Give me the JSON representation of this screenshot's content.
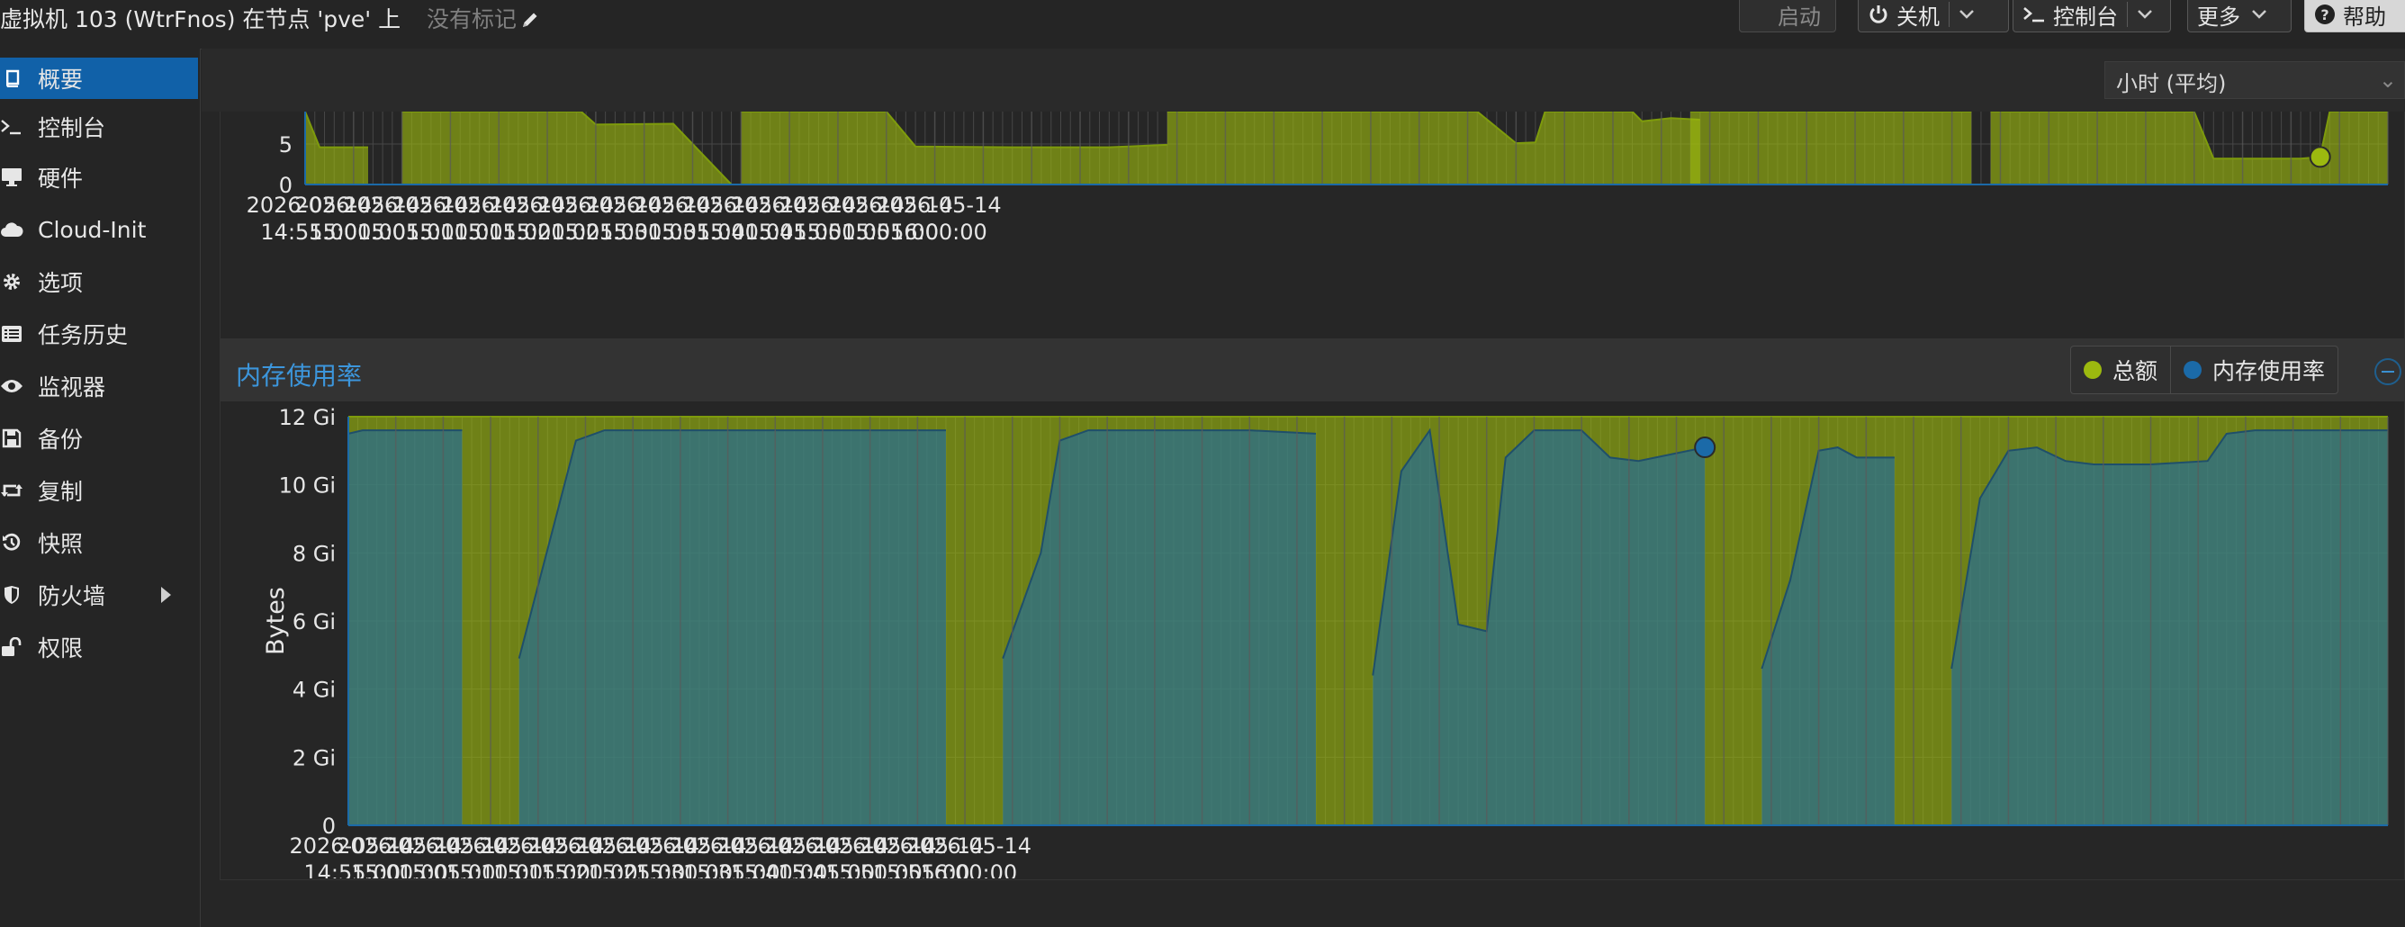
{
  "header": {
    "title": "虚拟机 103 (WtrFnos) 在节点 'pve' 上",
    "no_tags": "没有标记",
    "buttons": {
      "start": "启动",
      "shutdown": "关机",
      "console": "控制台",
      "more": "更多",
      "help": "帮助"
    }
  },
  "sidebar": {
    "items": [
      {
        "label": "概要",
        "icon": "book-icon"
      },
      {
        "label": "控制台",
        "icon": "terminal-icon"
      },
      {
        "label": "硬件",
        "icon": "desktop-icon"
      },
      {
        "label": "Cloud-Init",
        "icon": "cloud-icon"
      },
      {
        "label": "选项",
        "icon": "gear-icon"
      },
      {
        "label": "任务历史",
        "icon": "list-icon"
      },
      {
        "label": "监视器",
        "icon": "eye-icon"
      },
      {
        "label": "备份",
        "icon": "floppy-icon"
      },
      {
        "label": "复制",
        "icon": "retweet-icon"
      },
      {
        "label": "快照",
        "icon": "history-icon"
      },
      {
        "label": "防火墙",
        "icon": "shield-icon"
      },
      {
        "label": "权限",
        "icon": "unlock-icon"
      }
    ]
  },
  "timeframe": {
    "selected": "小时 (平均)"
  },
  "colors": {
    "total": "#9cb90f",
    "usage": "#1b6aa8",
    "active": "#1161a8",
    "title": "#3c96dc"
  },
  "time_labels": [
    [
      "2026-05-14",
      "14:55:00"
    ],
    [
      "2026-05-14",
      "15:00:00"
    ],
    [
      "2026-05-14",
      "15:05:00"
    ],
    [
      "2026-05-14",
      "15:10:00"
    ],
    [
      "2026-05-14",
      "15:15:00"
    ],
    [
      "2026-05-14",
      "15:20:00"
    ],
    [
      "2026-05-14",
      "15:25:00"
    ],
    [
      "2026-05-14",
      "15:30:00"
    ],
    [
      "2026-05-14",
      "15:35:00"
    ],
    [
      "2026-05-14",
      "15:40:00"
    ],
    [
      "2026-05-14",
      "15:45:00"
    ],
    [
      "2026-05-14",
      "15:50:00"
    ],
    [
      "2026-05-14",
      "15:55:00"
    ],
    [
      "2026-05-14",
      "16:00:00"
    ]
  ],
  "memory_panel": {
    "title": "内存使用率",
    "legend": [
      "总额",
      "内存使用率"
    ]
  },
  "chart_data": [
    {
      "type": "area",
      "x_start": "14:55:00",
      "ylim": [
        0,
        9
      ],
      "yticks": [
        "0",
        "5"
      ],
      "series": [
        {
          "name": "总额",
          "segments": [
            [
              [
                0,
                9
              ],
              [
                1.5,
                4.6
              ],
              [
                6.5,
                4.6
              ]
            ],
            [
              [
                10,
                9
              ],
              [
                28.5,
                9
              ],
              [
                30,
                7.4
              ],
              [
                38,
                7.5
              ],
              [
                40,
                5
              ],
              [
                44,
                0
              ],
              [
                45,
                0
              ]
            ],
            [
              [
                45,
                9
              ],
              [
                60,
                9
              ],
              [
                63,
                4.7
              ],
              [
                73,
                4.6
              ],
              [
                83,
                4.6
              ],
              [
                89,
                4.9
              ]
            ],
            [
              [
                89,
                9
              ],
              [
                121,
                9
              ],
              [
                125,
                5.1
              ],
              [
                127,
                5.2
              ],
              [
                128,
                9
              ],
              [
                137,
                9
              ],
              [
                138,
                7.8
              ],
              [
                141,
                8.2
              ],
              [
                144,
                8
              ]
            ],
            [
              [
                143,
                9
              ],
              [
                172,
                9
              ]
            ],
            [
              [
                174,
                9
              ],
              [
                195,
                9
              ],
              [
                197,
                3.2
              ],
              [
                206,
                3.2
              ],
              [
                208,
                3.4
              ],
              [
                209,
                9
              ],
              [
                215,
                9
              ]
            ]
          ]
        }
      ],
      "highlight": {
        "series": "总额",
        "x": 208,
        "y": 3.4
      }
    },
    {
      "type": "area",
      "title": "内存使用率",
      "x_start": "14:55:00",
      "ylabel": "Bytes",
      "ylim": [
        0,
        12
      ],
      "yticks": [
        "0",
        "2 Gi",
        "4 Gi",
        "6 Gi",
        "8 Gi",
        "10 Gi",
        "12 Gi"
      ],
      "series": [
        {
          "name": "总额",
          "segments": [
            [
              [
                0,
                12
              ],
              [
                215,
                12
              ]
            ]
          ]
        },
        {
          "name": "内存使用率",
          "segments": [
            [
              [
                0,
                11.5
              ],
              [
                1.5,
                11.6
              ],
              [
                12,
                11.6
              ]
            ],
            [
              [
                18,
                4.9
              ],
              [
                24,
                11.3
              ],
              [
                27,
                11.6
              ],
              [
                37,
                11.6
              ],
              [
                50,
                11.6
              ],
              [
                63,
                11.6
              ]
            ],
            [
              [
                69,
                4.9
              ],
              [
                73,
                8
              ],
              [
                75,
                11.3
              ],
              [
                78,
                11.6
              ],
              [
                95,
                11.6
              ],
              [
                102,
                11.5
              ]
            ],
            [
              [
                108,
                4.4
              ],
              [
                111,
                10.4
              ],
              [
                114,
                11.6
              ],
              [
                117,
                5.9
              ],
              [
                120,
                5.7
              ],
              [
                122,
                10.8
              ],
              [
                125,
                11.6
              ],
              [
                130,
                11.6
              ],
              [
                133,
                10.8
              ],
              [
                136,
                10.7
              ],
              [
                143,
                11.1
              ]
            ],
            [
              [
                149,
                4.6
              ],
              [
                152,
                7.2
              ],
              [
                155,
                11
              ],
              [
                157,
                11.1
              ],
              [
                159,
                10.8
              ],
              [
                163,
                10.8
              ]
            ],
            [
              [
                169,
                4.6
              ],
              [
                172,
                9.6
              ],
              [
                175,
                11
              ],
              [
                178,
                11.1
              ],
              [
                181,
                10.7
              ],
              [
                184,
                10.6
              ],
              [
                190,
                10.6
              ],
              [
                196,
                10.7
              ],
              [
                198,
                11.5
              ],
              [
                201,
                11.6
              ],
              [
                215,
                11.6
              ]
            ]
          ]
        }
      ],
      "highlight": {
        "series": "内存使用率",
        "x": 143,
        "y": 11.1
      }
    }
  ]
}
